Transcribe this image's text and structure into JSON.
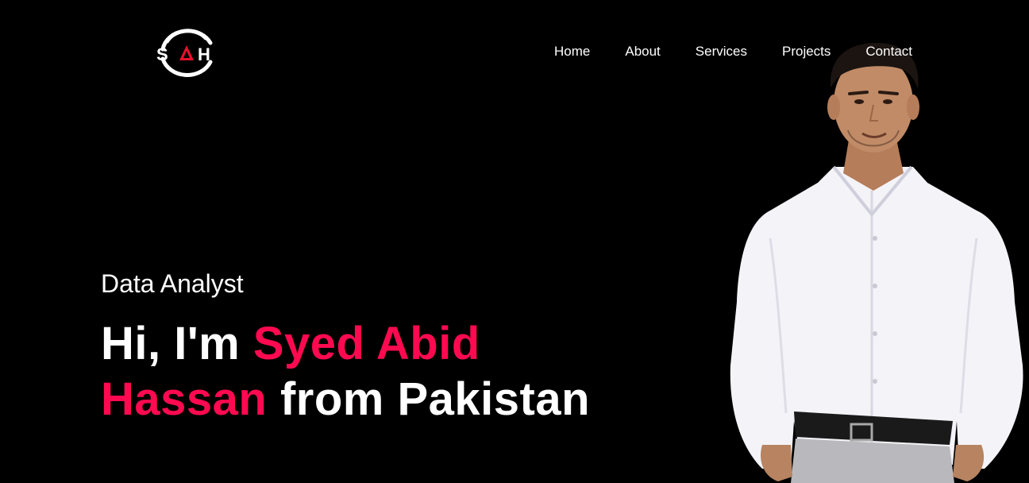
{
  "logo": {
    "text": "SAH"
  },
  "nav": {
    "items": [
      "Home",
      "About",
      "Services",
      "Projects",
      "Contact"
    ]
  },
  "hero": {
    "subtitle": "Data Analyst",
    "greeting": "Hi, I'm ",
    "name": "Syed Abid Hassan",
    "suffix": " from Pakistan"
  },
  "colors": {
    "background": "#000000",
    "text": "#ffffff",
    "accent": "#ff0a50"
  },
  "portrait": {
    "icon": "person-photo"
  }
}
